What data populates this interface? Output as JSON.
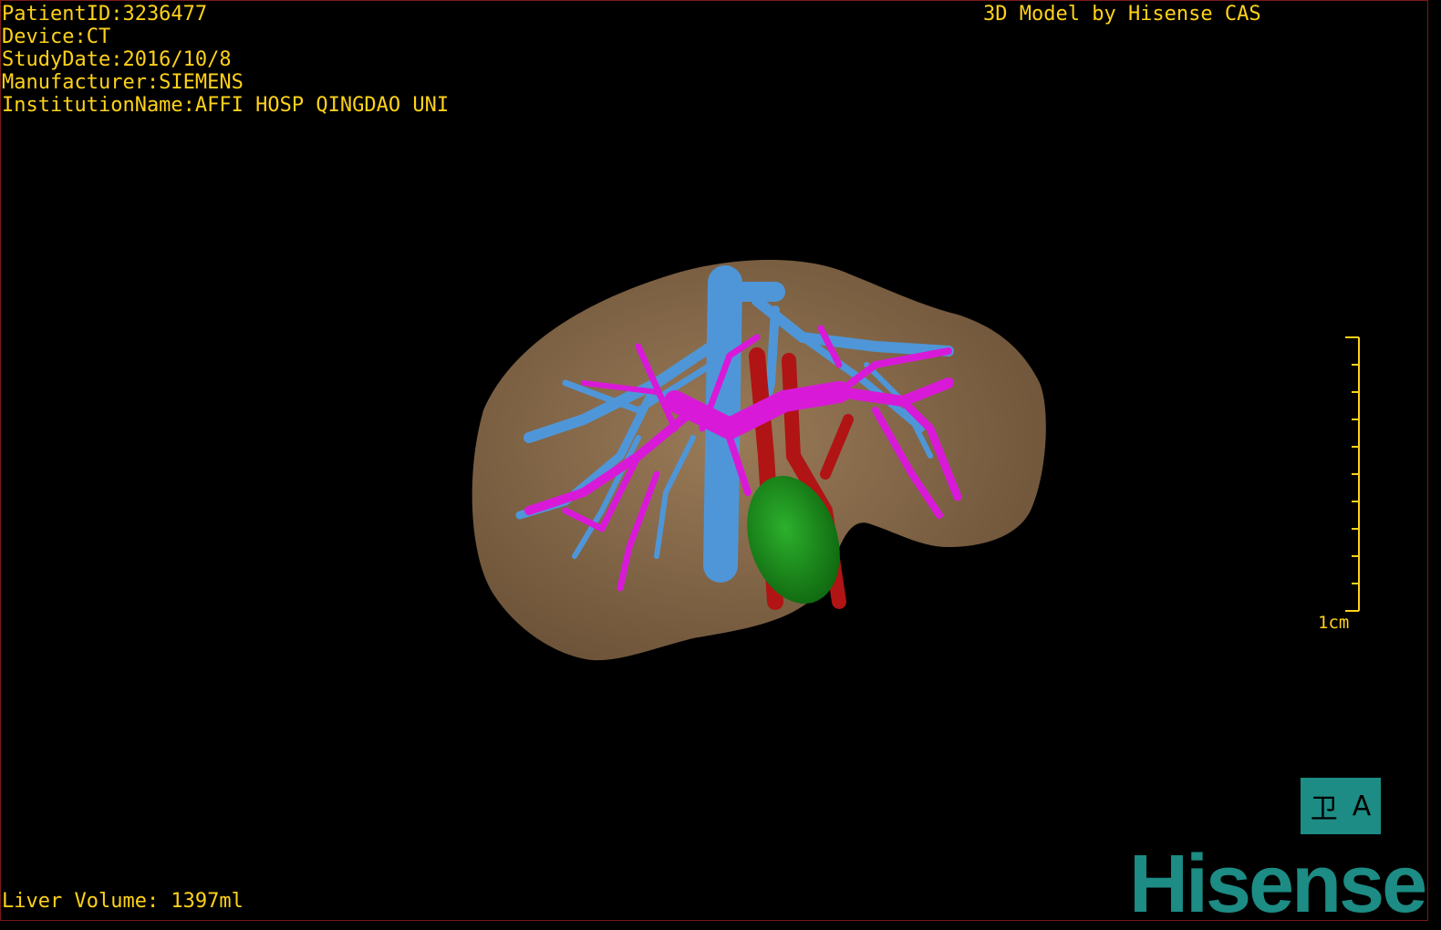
{
  "overlay": {
    "patient_id": "PatientID:3236477",
    "device": "Device:CT",
    "study_date": "StudyDate:2016/10/8",
    "manufacturer": "Manufacturer:SIEMENS",
    "institution": "InstitutionName:AFFI HOSP QINGDAO UNI",
    "brand_caption": "3D Model by Hisense CAS",
    "liver_volume": "Liver Volume: 1397ml"
  },
  "scale": {
    "label": "1cm"
  },
  "orientation_cube": {
    "left_glyph": "卫",
    "right_glyph": "A"
  },
  "logo": {
    "text": "Hisense"
  },
  "colors": {
    "text": "#ffd21a",
    "liver": "#8b6d4d",
    "portal_vein": "#d81ad8",
    "hepatic_vein": "#4f96d8",
    "artery": "#b01414",
    "tumor": "#1c8c1c",
    "brand": "#1c8c84"
  }
}
